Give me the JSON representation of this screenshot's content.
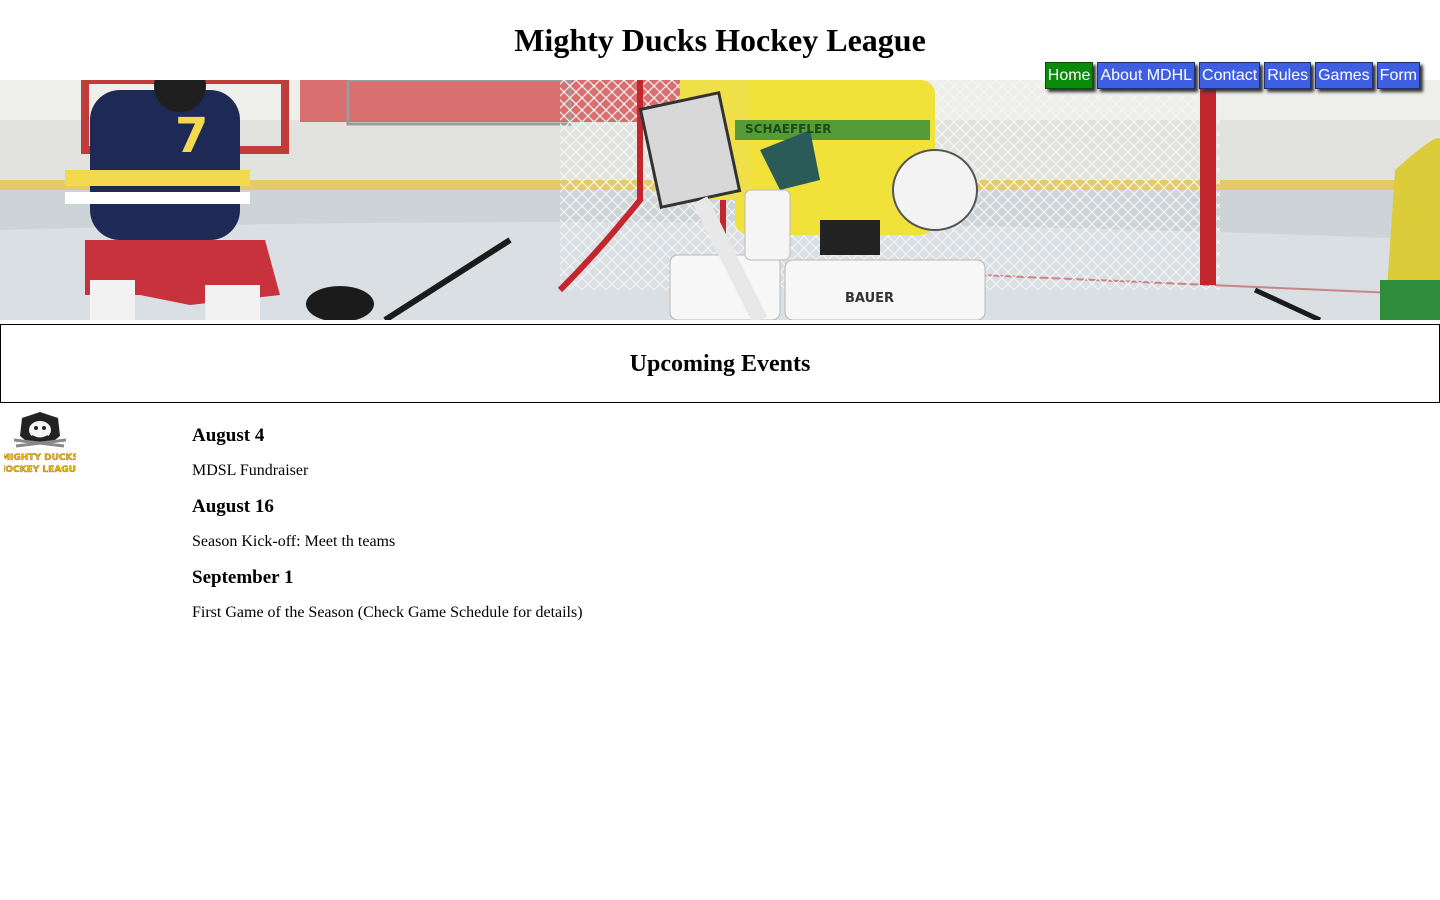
{
  "site": {
    "title": "Mighty Ducks Hockey League"
  },
  "nav": {
    "items": [
      {
        "label": "Home",
        "active": true
      },
      {
        "label": "About MDHL",
        "active": false
      },
      {
        "label": "Contact",
        "active": false
      },
      {
        "label": "Rules",
        "active": false
      },
      {
        "label": "Games",
        "active": false
      },
      {
        "label": "Form",
        "active": false
      }
    ]
  },
  "colors": {
    "nav_bg": "#3f5fe3",
    "nav_active_bg": "#0a8a0a",
    "logo_text": "#f2b705"
  },
  "logo": {
    "line1": "MIGHTY DUCKS",
    "line2": "HOCKEY LEAGUE"
  },
  "section": {
    "title": "Upcoming Events"
  },
  "events": [
    {
      "date": "August 4",
      "description": "MDSL Fundraiser"
    },
    {
      "date": "August 16",
      "description": "Season Kick-off: Meet th teams"
    },
    {
      "date": "September 1",
      "description": "First Game of the Season (Check Game Schedule for details)"
    }
  ],
  "banner": {
    "jersey_number": "7",
    "sponsor_text": "SCHAEFFLER",
    "brand_text": "BAUER"
  }
}
